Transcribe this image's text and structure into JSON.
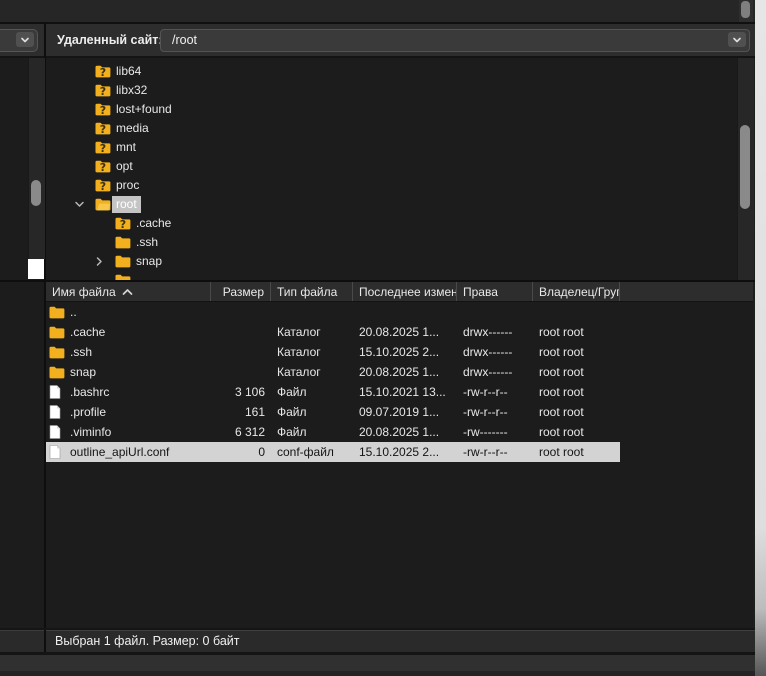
{
  "path_bar": {
    "label": "Удаленный сайт:",
    "value": "/root"
  },
  "tree": {
    "items": [
      {
        "label": "lib64",
        "icon": "folder-question",
        "level": 0,
        "chevron": null,
        "selected": false
      },
      {
        "label": "libx32",
        "icon": "folder-question",
        "level": 0,
        "chevron": null,
        "selected": false
      },
      {
        "label": "lost+found",
        "icon": "folder-question",
        "level": 0,
        "chevron": null,
        "selected": false
      },
      {
        "label": "media",
        "icon": "folder-question",
        "level": 0,
        "chevron": null,
        "selected": false
      },
      {
        "label": "mnt",
        "icon": "folder-question",
        "level": 0,
        "chevron": null,
        "selected": false
      },
      {
        "label": "opt",
        "icon": "folder-question",
        "level": 0,
        "chevron": null,
        "selected": false
      },
      {
        "label": "proc",
        "icon": "folder-question",
        "level": 0,
        "chevron": null,
        "selected": false
      },
      {
        "label": "root",
        "icon": "folder-open",
        "level": 0,
        "chevron": "down",
        "selected": true
      },
      {
        "label": ".cache",
        "icon": "folder-question",
        "level": 1,
        "chevron": null,
        "selected": false
      },
      {
        "label": ".ssh",
        "icon": "folder",
        "level": 1,
        "chevron": null,
        "selected": false
      },
      {
        "label": "snap",
        "icon": "folder",
        "level": 1,
        "chevron": "right",
        "selected": false
      },
      {
        "label": "",
        "icon": "folder",
        "level": 1,
        "chevron": null,
        "selected": false,
        "clipped": true
      }
    ]
  },
  "list": {
    "columns": [
      {
        "label": "Имя файла",
        "align": "left",
        "sorted": "asc"
      },
      {
        "label": "Размер",
        "align": "right",
        "sorted": null
      },
      {
        "label": "Тип файла",
        "align": "left",
        "sorted": null
      },
      {
        "label": "Последнее измен",
        "align": "left",
        "sorted": null
      },
      {
        "label": "Права",
        "align": "left",
        "sorted": null
      },
      {
        "label": "Владелец/Груп",
        "align": "left",
        "sorted": null
      }
    ],
    "rows": [
      {
        "name": "..",
        "icon": "folder",
        "size": "",
        "type": "",
        "modified": "",
        "perms": "",
        "owner": "",
        "selected": false
      },
      {
        "name": ".cache",
        "icon": "folder",
        "size": "",
        "type": "Каталог",
        "modified": "20.08.2025 1...",
        "perms": "drwx------",
        "owner": "root root",
        "selected": false
      },
      {
        "name": ".ssh",
        "icon": "folder",
        "size": "",
        "type": "Каталог",
        "modified": "15.10.2025 2...",
        "perms": "drwx------",
        "owner": "root root",
        "selected": false
      },
      {
        "name": "snap",
        "icon": "folder",
        "size": "",
        "type": "Каталог",
        "modified": "20.08.2025 1...",
        "perms": "drwx------",
        "owner": "root root",
        "selected": false
      },
      {
        "name": ".bashrc",
        "icon": "file",
        "size": "3 106",
        "type": "Файл",
        "modified": "15.10.2021 13...",
        "perms": "-rw-r--r--",
        "owner": "root root",
        "selected": false
      },
      {
        "name": ".profile",
        "icon": "file",
        "size": "161",
        "type": "Файл",
        "modified": "09.07.2019 1...",
        "perms": "-rw-r--r--",
        "owner": "root root",
        "selected": false
      },
      {
        "name": ".viminfo",
        "icon": "file",
        "size": "6 312",
        "type": "Файл",
        "modified": "20.08.2025 1...",
        "perms": "-rw-------",
        "owner": "root root",
        "selected": false
      },
      {
        "name": "outline_apiUrl.conf",
        "icon": "file",
        "size": "0",
        "type": "conf-файл",
        "modified": "15.10.2025 2...",
        "perms": "-rw-r--r--",
        "owner": "root root",
        "selected": true
      }
    ]
  },
  "status_bar": {
    "text": "Выбран 1 файл. Размер: 0 байт"
  },
  "colors": {
    "folder": "#F2B01E",
    "folder_dark": "#D29812",
    "question_mark": "#3A3110",
    "row_selection": "#D3D3D3",
    "tree_selection": "#C4C4C4",
    "panel_bg": "#1C1C1C"
  }
}
